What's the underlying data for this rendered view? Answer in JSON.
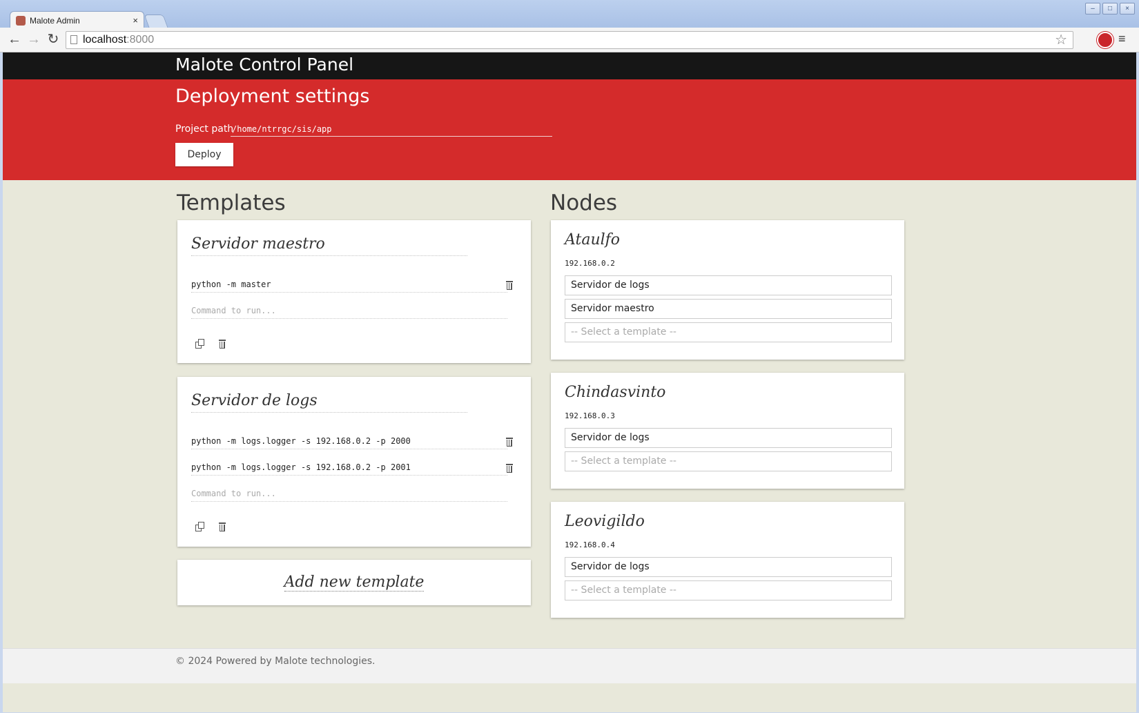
{
  "browser": {
    "tab_title": "Malote Admin",
    "tab_close": "×",
    "url_host": "localhost",
    "url_port": ":8000",
    "back": "←",
    "forward": "→",
    "reload": "↻",
    "bookmark_star": "☆",
    "menu": "≡",
    "window_minimize": "–",
    "window_maximize": "□",
    "window_close": "×"
  },
  "app": {
    "brand": "Malote Control Panel"
  },
  "deployment": {
    "title": "Deployment settings",
    "project_path_label": "Project path",
    "project_path_value": "/home/ntrrgc/sis/app",
    "deploy_button": "Deploy"
  },
  "templates": {
    "title": "Templates",
    "command_placeholder": "Command to run...",
    "items": [
      {
        "name": "Servidor maestro",
        "commands": [
          "python -m master"
        ]
      },
      {
        "name": "Servidor de logs",
        "commands": [
          "python -m logs.logger -s 192.168.0.2 -p 2000",
          "python -m logs.logger -s 192.168.0.2 -p 2001"
        ]
      }
    ],
    "add_new": "Add new template"
  },
  "nodes": {
    "title": "Nodes",
    "select_placeholder": "-- Select a template --",
    "items": [
      {
        "name": "Ataulfo",
        "ip": "192.168.0.2",
        "templates": [
          "Servidor de logs",
          "Servidor maestro"
        ]
      },
      {
        "name": "Chindasvinto",
        "ip": "192.168.0.3",
        "templates": [
          "Servidor de logs"
        ]
      },
      {
        "name": "Leovigildo",
        "ip": "192.168.0.4",
        "templates": [
          "Servidor de logs"
        ]
      }
    ]
  },
  "footer": {
    "text": "© 2024 Powered by Malote technologies."
  },
  "colors": {
    "navbar": "#161616",
    "hero": "#d42b2b",
    "background": "#e8e8da"
  }
}
